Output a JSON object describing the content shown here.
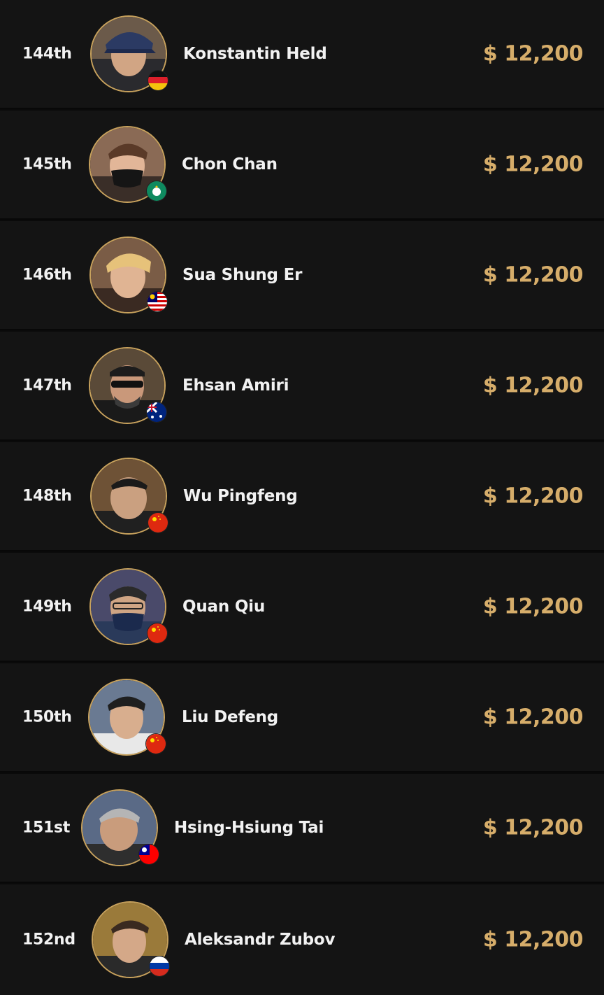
{
  "accent_color": "#d6ad6a",
  "results": [
    {
      "rank": "144th",
      "name": "Konstantin Held",
      "prize": "$ 12,200",
      "flag": "germany-flag-icon"
    },
    {
      "rank": "145th",
      "name": "Chon Chan",
      "prize": "$ 12,200",
      "flag": "macau-flag-icon"
    },
    {
      "rank": "146th",
      "name": "Sua Shung Er",
      "prize": "$ 12,200",
      "flag": "malaysia-flag-icon"
    },
    {
      "rank": "147th",
      "name": "Ehsan Amiri",
      "prize": "$ 12,200",
      "flag": "australia-flag-icon"
    },
    {
      "rank": "148th",
      "name": "Wu Pingfeng",
      "prize": "$ 12,200",
      "flag": "china-flag-icon"
    },
    {
      "rank": "149th",
      "name": "Quan Qiu",
      "prize": "$ 12,200",
      "flag": "china-flag-icon"
    },
    {
      "rank": "150th",
      "name": "Liu Defeng",
      "prize": "$ 12,200",
      "flag": "china-flag-icon"
    },
    {
      "rank": "151st",
      "name": "Hsing-Hsiung Tai",
      "prize": "$ 12,200",
      "flag": "taiwan-flag-icon"
    },
    {
      "rank": "152nd",
      "name": "Aleksandr Zubov",
      "prize": "$ 12,200",
      "flag": "russia-flag-icon"
    }
  ]
}
